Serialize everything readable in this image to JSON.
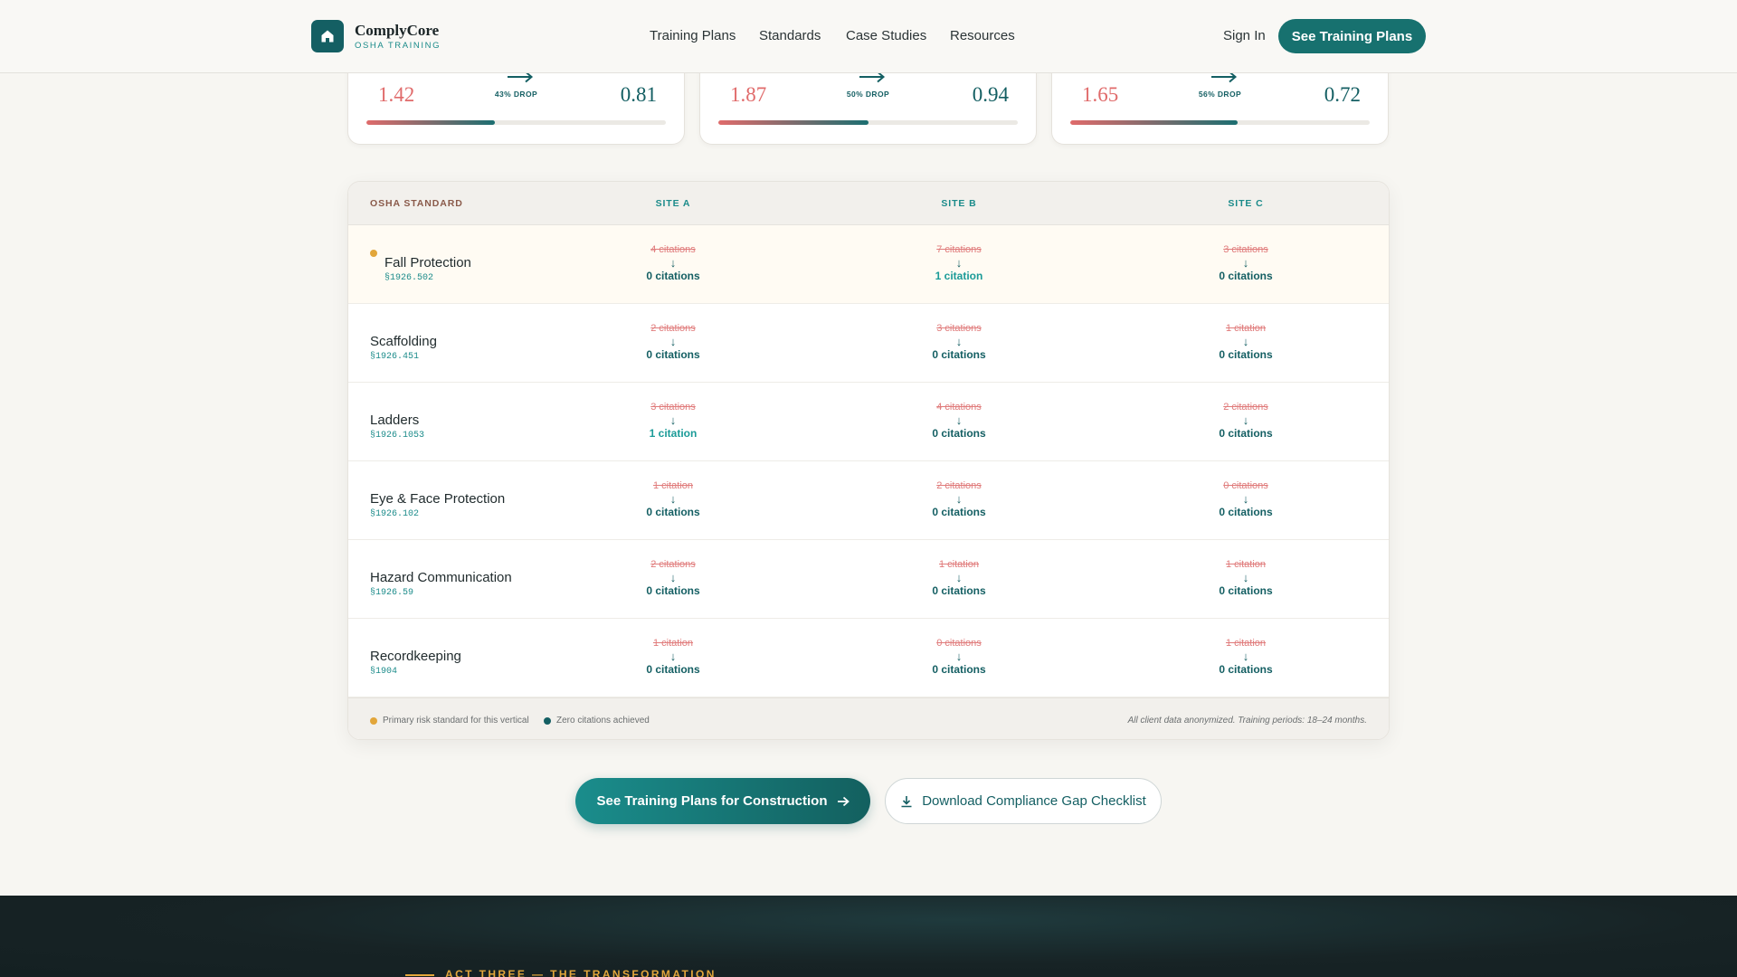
{
  "header": {
    "brand": "ComplyCore",
    "brand_sub": "OSHA TRAINING",
    "nav": [
      "Training Plans",
      "Standards",
      "Case Studies",
      "Resources"
    ],
    "sign_in": "Sign In",
    "cta": "See Training Plans"
  },
  "metrics": [
    {
      "before": "1.42",
      "after": "0.81",
      "drop_label": "43% DROP",
      "progress": 0.43
    },
    {
      "before": "1.87",
      "after": "0.94",
      "drop_label": "50% DROP",
      "progress": 0.5
    },
    {
      "before": "1.65",
      "after": "0.72",
      "drop_label": "56% DROP",
      "progress": 0.56
    }
  ],
  "table": {
    "headers": [
      "OSHA STANDARD",
      "SITE A",
      "SITE B",
      "SITE C"
    ],
    "rows": [
      {
        "name": "Fall Protection",
        "code": "§1926.502",
        "primary": true,
        "cells": [
          {
            "old": "4 citations",
            "new": "0 citations"
          },
          {
            "old": "7 citations",
            "new": "1 citation"
          },
          {
            "old": "3 citations",
            "new": "0 citations"
          }
        ]
      },
      {
        "name": "Scaffolding",
        "code": "§1926.451",
        "primary": false,
        "cells": [
          {
            "old": "2 citations",
            "new": "0 citations"
          },
          {
            "old": "3 citations",
            "new": "0 citations"
          },
          {
            "old": "1 citation",
            "new": "0 citations"
          }
        ]
      },
      {
        "name": "Ladders",
        "code": "§1926.1053",
        "primary": false,
        "cells": [
          {
            "old": "3 citations",
            "new": "1 citation"
          },
          {
            "old": "4 citations",
            "new": "0 citations"
          },
          {
            "old": "2 citations",
            "new": "0 citations"
          }
        ]
      },
      {
        "name": "Eye & Face Protection",
        "code": "§1926.102",
        "primary": false,
        "cells": [
          {
            "old": "1 citation",
            "new": "0 citations"
          },
          {
            "old": "2 citations",
            "new": "0 citations"
          },
          {
            "old": "0 citations",
            "new": "0 citations"
          }
        ]
      },
      {
        "name": "Hazard Communication",
        "code": "§1926.59",
        "primary": false,
        "cells": [
          {
            "old": "2 citations",
            "new": "0 citations"
          },
          {
            "old": "1 citation",
            "new": "0 citations"
          },
          {
            "old": "1 citation",
            "new": "0 citations"
          }
        ]
      },
      {
        "name": "Recordkeeping",
        "code": "§1904",
        "primary": false,
        "cells": [
          {
            "old": "1 citation",
            "new": "0 citations"
          },
          {
            "old": "0 citations",
            "new": "0 citations"
          },
          {
            "old": "1 citation",
            "new": "0 citations"
          }
        ]
      }
    ],
    "legend": {
      "primary": "Primary risk standard for this vertical",
      "zero": "Zero citations achieved",
      "note": "All client data anonymized. Training periods: 18–24 months."
    }
  },
  "ctas": {
    "primary": "See Training Plans for Construction",
    "secondary": "Download Compliance Gap Checklist"
  },
  "next_section": {
    "label": "ACT THREE — THE TRANSFORMATION"
  },
  "colors": {
    "brand": "#145f63",
    "accent": "#1b8b8a",
    "before_red": "#e06b6b",
    "highlight_gold": "#e2a63a"
  }
}
